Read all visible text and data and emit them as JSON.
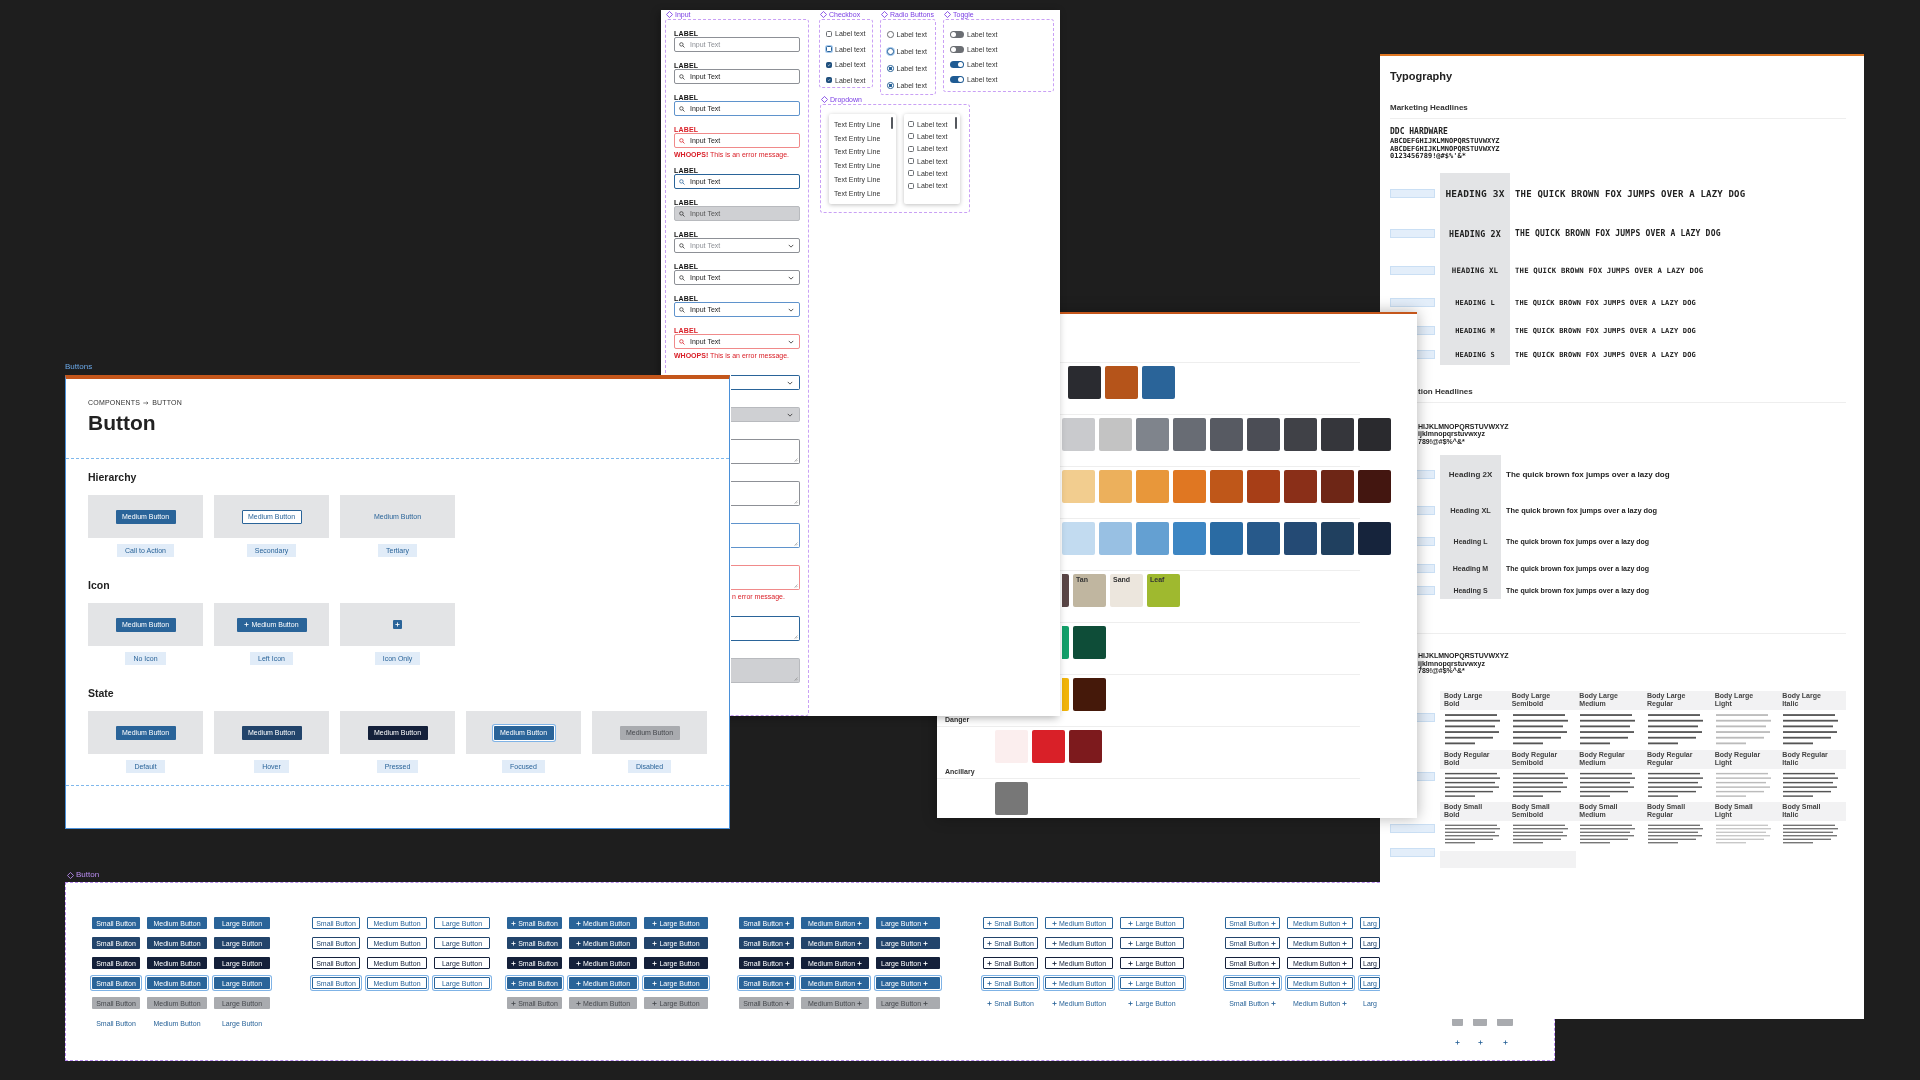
{
  "button_matrix": {
    "title": "Button",
    "groups": [
      {
        "kind": "plain",
        "rows": [
          {
            "kind": "primary",
            "buttons": [
              "Small Button",
              "Medium Button",
              "Large Button"
            ]
          },
          {
            "kind": "hover",
            "buttons": [
              "Small Button",
              "Medium Button",
              "Large Button"
            ]
          },
          {
            "kind": "pressed",
            "buttons": [
              "Small Button",
              "Medium Button",
              "Large Button"
            ]
          },
          {
            "kind": "focused",
            "buttons": [
              "Small Button",
              "Medium Button",
              "Large Button"
            ]
          },
          {
            "kind": "disabled",
            "buttons": [
              "Small Button",
              "Medium Button",
              "Large Button"
            ]
          },
          {
            "kind": "tertiary",
            "buttons": [
              "Small Button",
              "Medium Button",
              "Large Button"
            ]
          }
        ]
      },
      {
        "kind": "plain",
        "rows": [
          {
            "kind": "secondary",
            "buttons": [
              "Small Button",
              "Medium Button",
              "Large Button"
            ]
          },
          {
            "kind": "secondaryhover",
            "buttons": [
              "Small Button",
              "Medium Button",
              "Large Button"
            ]
          },
          {
            "kind": "secondarypressed",
            "buttons": [
              "Small Button",
              "Medium Button",
              "Large Button"
            ]
          },
          {
            "kind": "secondaryfocused",
            "buttons": [
              "Small Button",
              "Medium Button",
              "Large Button"
            ]
          }
        ]
      },
      {
        "kind": "lefticon",
        "rows": [
          {
            "kind": "primary",
            "buttons": [
              "Small Button",
              "Medium Button",
              "Large Button"
            ]
          },
          {
            "kind": "hover",
            "buttons": [
              "Small Button",
              "Medium Button",
              "Large Button"
            ]
          },
          {
            "kind": "pressed",
            "buttons": [
              "Small Button",
              "Medium Button",
              "Large Button"
            ]
          },
          {
            "kind": "focused",
            "buttons": [
              "Small Button",
              "Medium Button",
              "Large Button"
            ]
          },
          {
            "kind": "disabled",
            "buttons": [
              "Small Button",
              "Medium Button",
              "Large Button"
            ]
          }
        ]
      },
      {
        "kind": "righticon",
        "rows": [
          {
            "kind": "primary",
            "buttons": [
              "Small Button",
              "Medium Button",
              "Large Button"
            ]
          },
          {
            "kind": "hover",
            "buttons": [
              "Small Button",
              "Medium Button",
              "Large Button"
            ]
          },
          {
            "kind": "pressed",
            "buttons": [
              "Small Button",
              "Medium Button",
              "Large Button"
            ]
          },
          {
            "kind": "focused",
            "buttons": [
              "Small Button",
              "Medium Button",
              "Large Button"
            ]
          },
          {
            "kind": "disabled",
            "buttons": [
              "Small Button",
              "Medium Button",
              "Large Button"
            ]
          }
        ]
      },
      {
        "kind": "lefticon",
        "rows": [
          {
            "kind": "secondary",
            "buttons": [
              "Small Button",
              "Medium Button",
              "Large Button"
            ]
          },
          {
            "kind": "secondaryhover",
            "buttons": [
              "Small Button",
              "Medium Button",
              "Large Button"
            ]
          },
          {
            "kind": "secondarypressed",
            "buttons": [
              "Small Button",
              "Medium Button",
              "Large Button"
            ]
          },
          {
            "kind": "secondaryfocused",
            "buttons": [
              "Small Button",
              "Medium Button",
              "Large Button"
            ]
          },
          {
            "kind": "tertiary",
            "buttons": [
              "Small Button",
              "Medium Button",
              "Large Button"
            ]
          }
        ]
      },
      {
        "kind": "righticon",
        "rows": [
          {
            "kind": "secondary",
            "buttons": [
              "Small Button",
              "Medium Button",
              "Larg"
            ]
          },
          {
            "kind": "secondaryhover",
            "buttons": [
              "Small Button",
              "Medium Button",
              "Larg"
            ]
          },
          {
            "kind": "secondarypressed",
            "buttons": [
              "Small Button",
              "Medium Button",
              "Larg"
            ]
          },
          {
            "kind": "secondaryfocused",
            "buttons": [
              "Small Button",
              "Medium Button",
              "Larg"
            ]
          },
          {
            "kind": "tertiary",
            "buttons": [
              "Small Button",
              "Medium Button",
              "Larg"
            ]
          }
        ]
      }
    ],
    "icon_only": {
      "rows": [
        {
          "kind": "disabled",
          "buttons": [
            {
              "kind": "small"
            },
            {
              "kind": "medium"
            },
            {
              "kind": "large"
            }
          ]
        },
        {
          "kind": "tertiary",
          "buttons": [
            {
              "kind": "small"
            },
            {
              "kind": "medium"
            },
            {
              "kind": "large"
            }
          ]
        }
      ]
    }
  },
  "typography": {
    "title": "Typography",
    "marketing": {
      "title": "Marketing Headlines",
      "font_name": "DDC HARDWARE",
      "specimen": [
        "ABCDEFGHIJKLMNOPQRSTUVWXYZ",
        "ABCDEFGHIJKLMNOPQRSTUVWXYZ",
        "0123456789!@#$%'&*"
      ],
      "headings": [
        {
          "kind": "xxxl",
          "name": "HEADING 3X",
          "sample": "THE QUICK BROWN FOX JUMPS OVER A LAZY DOG"
        },
        {
          "kind": "xxl",
          "name": "HEADING 2X",
          "sample": "THE QUICK BROWN FOX JUMPS OVER A LAZY DOG"
        },
        {
          "kind": "xl",
          "name": "HEADING XL",
          "sample": "THE QUICK BROWN FOX JUMPS OVER A LAZY DOG"
        },
        {
          "kind": "large",
          "name": "HEADING L",
          "sample": "THE QUICK BROWN FOX JUMPS OVER A LAZY DOG"
        },
        {
          "kind": "medium",
          "name": "HEADING M",
          "sample": "THE QUICK BROWN FOX JUMPS OVER A LAZY DOG"
        },
        {
          "kind": "small",
          "name": "HEADING S",
          "sample": "THE QUICK BROWN FOX JUMPS OVER A LAZY DOG"
        }
      ]
    },
    "product": {
      "title": "tion Headlines",
      "specimen": [
        "HIJKLMNOPQRSTUVWXYZ",
        "ijklmnopqrstuvwxyz",
        "789!@#$%^&*"
      ],
      "headings": [
        {
          "kind": "xxl",
          "name": "Heading 2X",
          "sample": "The quick brown fox jumps over a lazy dog"
        },
        {
          "kind": "xl",
          "name": "Heading XL",
          "sample": "The quick brown fox jumps over a lazy dog"
        },
        {
          "kind": "large",
          "name": "Heading L",
          "sample": "The quick brown fox jumps over a lazy dog"
        },
        {
          "kind": "medium",
          "name": "Heading M",
          "sample": "The quick brown fox jumps over a lazy dog"
        },
        {
          "kind": "small",
          "name": "Heading S",
          "sample": "The quick brown fox jumps over a lazy dog"
        }
      ]
    },
    "body": {
      "specimen": [
        "HIJKLMNOPQRSTUVWXYZ",
        "ijklmnopqrstuvwxyz",
        "789!@#$%^&*"
      ],
      "rows": [
        {
          "kind": "large",
          "cells": [
            {
              "name": "Body Large",
              "style": "Bold"
            },
            {
              "name": "Body Large",
              "style": "Semibold"
            },
            {
              "name": "Body Large",
              "style": "Medium"
            },
            {
              "name": "Body Large",
              "style": "Regular"
            },
            {
              "name": "Body Large",
              "style": "Light"
            },
            {
              "name": "Body Large",
              "style": "Italic"
            }
          ]
        },
        {
          "kind": "regular",
          "cells": [
            {
              "name": "Body Regular",
              "style": "Bold"
            },
            {
              "name": "Body Regular",
              "style": "Semibold"
            },
            {
              "name": "Body Regular",
              "style": "Medium"
            },
            {
              "name": "Body Regular",
              "style": "Regular"
            },
            {
              "name": "Body Regular",
              "style": "Light"
            },
            {
              "name": "Body Regular",
              "style": "Italic"
            }
          ]
        },
        {
          "kind": "small",
          "cells": [
            {
              "name": "Body Small",
              "style": "Bold"
            },
            {
              "name": "Body Small",
              "style": "Semibold"
            },
            {
              "name": "Body Small",
              "style": "Medium"
            },
            {
              "name": "Body Small",
              "style": "Regular"
            },
            {
              "name": "Body Small",
              "style": "Light"
            },
            {
              "name": "Body Small",
              "style": "Italic"
            }
          ]
        }
      ]
    }
  },
  "palette": {
    "rows": [
      {
        "kind": "brand",
        "swatches": [
          {
            "color": "#2a2b30"
          },
          {
            "color": "#b5541a"
          },
          {
            "color": "#2a6499"
          }
        ]
      },
      {
        "kind": "scale",
        "swatches": [
          {
            "color": "#c9cacd"
          },
          {
            "color": "#c3c3c3"
          },
          {
            "color": "#7f848c"
          },
          {
            "color": "#686c74"
          },
          {
            "color": "#575a62"
          },
          {
            "color": "#4b4d55"
          },
          {
            "color": "#404147"
          },
          {
            "color": "#35363b"
          },
          {
            "color": "#2a2a2e"
          }
        ]
      },
      {
        "kind": "scale",
        "swatches": [
          {
            "color": "#f2cd8f"
          },
          {
            "color": "#ecb05c"
          },
          {
            "color": "#e8973a"
          },
          {
            "color": "#e07722"
          },
          {
            "color": "#bf5719"
          },
          {
            "color": "#a73e17"
          },
          {
            "color": "#8a2f18"
          },
          {
            "color": "#6e2616"
          },
          {
            "color": "#431610"
          }
        ]
      },
      {
        "kind": "scale",
        "swatches": [
          {
            "color": "#c2dbf0"
          },
          {
            "color": "#98c0e3"
          },
          {
            "color": "#64a0d2"
          },
          {
            "color": "#3d86c3"
          },
          {
            "color": "#2a6ba3"
          },
          {
            "color": "#27598a"
          },
          {
            "color": "#244a74"
          },
          {
            "color": "#20405f"
          },
          {
            "color": "#16243c"
          }
        ]
      },
      {
        "kind": "accent",
        "swatches": [
          {
            "color": "#5a4646"
          },
          {
            "color": "#c0b6a0",
            "label": "Tan"
          },
          {
            "color": "#ece6dd",
            "label": "Sand"
          },
          {
            "color": "#9fb92f",
            "label": "Leaf"
          }
        ]
      },
      {
        "kind": "accent",
        "swatches": [
          {
            "color": "#13a06a"
          },
          {
            "color": "#0e4d38"
          }
        ]
      },
      {
        "kind": "accent",
        "swatches": [
          {
            "color": "#f1b40b"
          },
          {
            "color": "#45190a"
          }
        ]
      },
      {
        "kind": "group",
        "title": "Danger",
        "swatches": [
          {
            "color": "#fbeeee"
          },
          {
            "color": "#d92028"
          },
          {
            "color": "#7d1a1d"
          }
        ]
      },
      {
        "kind": "group",
        "title": "Ancillary",
        "swatches": [
          {
            "color": "#777777"
          }
        ]
      }
    ]
  },
  "input_board": {
    "input_group": {
      "title": "Input",
      "fields": [
        {
          "kind": "text",
          "label": "LABEL",
          "placeholder": "Input Text",
          "hovered": false,
          "focused": false,
          "disabled": false
        },
        {
          "kind": "text",
          "label": "LABEL",
          "value": "Input Text",
          "hovered": false,
          "focused": false,
          "disabled": false
        },
        {
          "kind": "text",
          "label": "LABEL",
          "value": "Input Text",
          "hovered": true,
          "focused": false,
          "disabled": false
        },
        {
          "kind": "text",
          "label": "LABEL",
          "value": "Input Text",
          "hovered": false,
          "focused": false,
          "disabled": false,
          "error": "**WHOOPS!** This is an error message."
        },
        {
          "kind": "text",
          "label": "LABEL",
          "value": "Input Text",
          "hovered": false,
          "focused": true,
          "disabled": false
        },
        {
          "kind": "text",
          "label": "LABEL",
          "value": "Input Text",
          "hovered": false,
          "focused": false,
          "disabled": true
        },
        {
          "kind": "dropdown",
          "label": "LABEL",
          "placeholder": "Input Text",
          "hovered": false,
          "focused": false,
          "disabled": false
        },
        {
          "kind": "dropdown",
          "label": "LABEL",
          "value": "Input Text",
          "hovered": false,
          "focused": false,
          "disabled": false
        },
        {
          "kind": "dropdown",
          "label": "LABEL",
          "value": "Input Text",
          "hovered": true,
          "focused": false,
          "disabled": false
        },
        {
          "kind": "dropdown",
          "label": "LABEL",
          "value": "Input Text",
          "hovered": false,
          "focused": false,
          "disabled": false,
          "error": "**WHOOPS!** This is an error message."
        },
        {
          "kind": "dropdown",
          "hovered": false,
          "focused": true,
          "disabled": false
        },
        {
          "kind": "dropdown",
          "hovered": false,
          "focused": false,
          "disabled": true
        },
        {
          "kind": "textarea",
          "hovered": false,
          "focused": false,
          "disabled": false
        },
        {
          "kind": "textarea",
          "hovered": false,
          "focused": false,
          "disabled": false
        },
        {
          "kind": "textarea",
          "hovered": true,
          "focused": false,
          "disabled": false
        },
        {
          "kind": "textarea",
          "hovered": false,
          "focused": false,
          "disabled": false,
          "error": "n error message."
        },
        {
          "kind": "textarea",
          "hovered": false,
          "focused": true,
          "disabled": false
        },
        {
          "kind": "textarea",
          "hovered": false,
          "focused": false,
          "disabled": true
        }
      ]
    },
    "checkbox_group": {
      "title": "Checkbox",
      "items": [
        {
          "label": "Label text",
          "checked": false,
          "hovered": false
        },
        {
          "label": "Label text",
          "checked": false,
          "hovered": true
        },
        {
          "label": "Label text",
          "checked": true,
          "hovered": false
        },
        {
          "label": "Label text",
          "checked": true,
          "hovered": false
        }
      ]
    },
    "radio_group": {
      "title": "Radio Buttons",
      "items": [
        {
          "label": "Label text",
          "selected": false,
          "hovered": false
        },
        {
          "label": "Label text",
          "selected": false,
          "hovered": true
        },
        {
          "label": "Label text",
          "selected": true,
          "hovered": false
        },
        {
          "label": "Label text",
          "selected": true,
          "hovered": false
        }
      ]
    },
    "toggle_group": {
      "title": "Toggle",
      "items": [
        {
          "label": "Label text",
          "on": false
        },
        {
          "label": "Label text",
          "on": false
        },
        {
          "label": "Label text",
          "on": true
        },
        {
          "label": "Label text",
          "on": true
        }
      ]
    },
    "dropdown_group": {
      "title": "Dropdown",
      "menus": [
        {
          "kind": "plain",
          "items": [
            {
              "label": "Text Entry Line"
            },
            {
              "label": "Text Entry Line"
            },
            {
              "label": "Text Entry Line"
            },
            {
              "label": "Text Entry Line"
            },
            {
              "label": "Text Entry Line"
            },
            {
              "label": "Text Entry Line"
            }
          ]
        },
        {
          "kind": "checklist",
          "items": [
            {
              "label": "Label text",
              "checked": false
            },
            {
              "label": "Label text",
              "checked": false
            },
            {
              "label": "Label text",
              "checked": false
            },
            {
              "label": "Label text",
              "checked": false
            },
            {
              "label": "Label text",
              "checked": false
            },
            {
              "label": "Label text",
              "checked": false
            }
          ]
        }
      ]
    }
  },
  "button_page": {
    "frame_label": "Buttons",
    "breadcrumb": [
      "COMPONENTS",
      "BUTTON"
    ],
    "title": "Button",
    "sections": [
      {
        "title": "Hierarchy",
        "cards": [
          {
            "caption": "Call to Action",
            "button": {
              "kind": "primary",
              "label": "Medium Button"
            }
          },
          {
            "caption": "Secondary",
            "button": {
              "kind": "secondary",
              "label": "Medium Button"
            }
          },
          {
            "caption": "Tertiary",
            "button": {
              "kind": "tertiary",
              "label": "Medium Button"
            }
          }
        ]
      },
      {
        "title": "Icon",
        "cards": [
          {
            "caption": "No Icon",
            "button": {
              "kind": "primary",
              "label": "Medium Button"
            }
          },
          {
            "caption": "Left Icon",
            "button": {
              "kind": "lefticon",
              "label": "Medium Button"
            }
          },
          {
            "caption": "Icon Only",
            "button": {
              "kind": "icononly"
            }
          }
        ]
      },
      {
        "title": "State",
        "cards": [
          {
            "caption": "Default",
            "button": {
              "kind": "primary",
              "label": "Medium Button"
            }
          },
          {
            "caption": "Hover",
            "button": {
              "kind": "hover",
              "label": "Medium Button"
            }
          },
          {
            "caption": "Pressed",
            "button": {
              "kind": "pressed",
              "label": "Medium Button"
            }
          },
          {
            "caption": "Focused",
            "button": {
              "kind": "focused",
              "label": "Medium Button"
            }
          },
          {
            "caption": "Disabled",
            "button": {
              "kind": "disabled",
              "label": "Medium Button"
            }
          }
        ]
      }
    ]
  }
}
